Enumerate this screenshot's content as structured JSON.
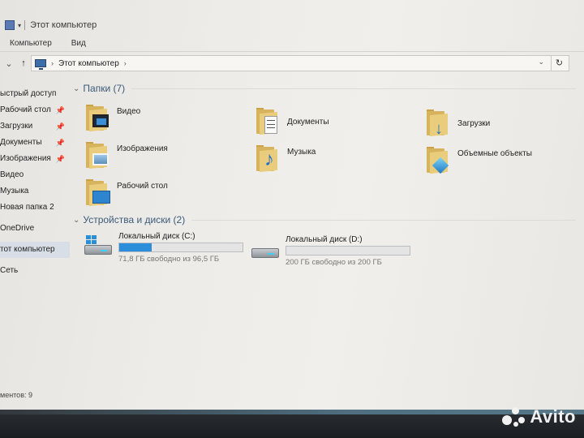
{
  "window": {
    "title": "Этот компьютер"
  },
  "ribbon": {
    "tabs": [
      "Компьютер",
      "Вид"
    ]
  },
  "address": {
    "crumbs": [
      "Этот компьютер"
    ]
  },
  "sidebar": {
    "items": [
      {
        "label": "ыстрый доступ",
        "pinned": false
      },
      {
        "label": "Рабочий стол",
        "pinned": true
      },
      {
        "label": "Загрузки",
        "pinned": true
      },
      {
        "label": "Документы",
        "pinned": true
      },
      {
        "label": "Изображения",
        "pinned": true
      },
      {
        "label": "Видео",
        "pinned": false
      },
      {
        "label": "Музыка",
        "pinned": false
      },
      {
        "label": "Новая папка 2",
        "pinned": false
      },
      {
        "label": "OneDrive",
        "pinned": false
      },
      {
        "label": "тот компьютер",
        "pinned": false,
        "selected": true
      },
      {
        "label": "Сеть",
        "pinned": false
      }
    ],
    "pin_glyph": "📌"
  },
  "folders_group": {
    "title": "Папки (7)",
    "items": [
      {
        "label": "Видео",
        "icon": "video-folder-icon"
      },
      {
        "label": "Документы",
        "icon": "documents-folder-icon"
      },
      {
        "label": "Загрузки",
        "icon": "downloads-folder-icon"
      },
      {
        "label": "Изображения",
        "icon": "pictures-folder-icon"
      },
      {
        "label": "Музыка",
        "icon": "music-folder-icon"
      },
      {
        "label": "Объемные объекты",
        "icon": "3d-objects-folder-icon"
      },
      {
        "label": "Рабочий стол",
        "icon": "desktop-folder-icon"
      }
    ]
  },
  "drives_group": {
    "title": "Устройства и диски (2)",
    "items": [
      {
        "name": "Локальный диск (C:)",
        "free": "71,8 ГБ свободно из 96,5 ГБ",
        "used_fraction": 0.26,
        "system": true
      },
      {
        "name": "Локальный диск (D:)",
        "free": "200 ГБ свободно из 200 ГБ",
        "used_fraction": 0.0,
        "system": false
      }
    ]
  },
  "status": {
    "items_text": "ментов: 9"
  },
  "watermark": {
    "text": "Avito"
  },
  "colors": {
    "accent": "#2a8edb",
    "group_title": "#3b5a7a",
    "folder": "#e9cd7c"
  }
}
